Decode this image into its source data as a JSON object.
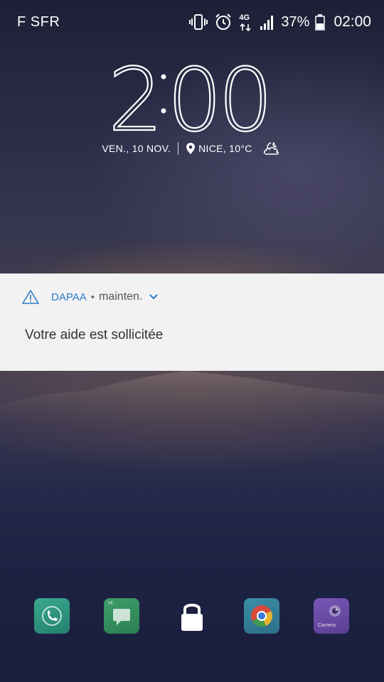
{
  "status_bar": {
    "carrier": "F SFR",
    "network": "4G",
    "battery_percent": "37%",
    "time": "02:00",
    "icons": [
      "vibrate-icon",
      "alarm-icon",
      "network-4g-icon",
      "signal-icon",
      "battery-icon"
    ]
  },
  "lockscreen": {
    "clock_hours": "2",
    "clock_minutes": "00",
    "date": "VEN., 10 NOV.",
    "location": "NICE, 10°C",
    "weather_icon": "moon-cloud-icon"
  },
  "notification": {
    "app_name": "DAPAA",
    "separator": "•",
    "subtext": "mainten.",
    "message": "Votre aide est sollicitée",
    "icon": "warning-icon",
    "accent_color": "#2a7cc7"
  },
  "dock": {
    "items": [
      {
        "name": "phone",
        "icon": "phone-icon"
      },
      {
        "name": "messages",
        "icon": "messages-icon",
        "label": "Hi"
      },
      {
        "name": "lock",
        "icon": "lock-icon"
      },
      {
        "name": "chrome",
        "icon": "chrome-icon"
      },
      {
        "name": "camera",
        "icon": "camera-icon",
        "label": "Camera"
      }
    ]
  }
}
